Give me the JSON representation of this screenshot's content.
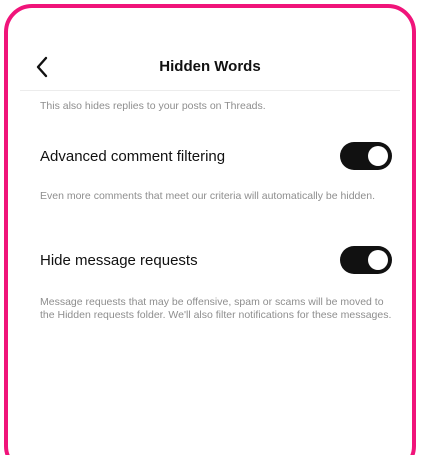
{
  "header": {
    "title": "Hidden Words",
    "back_icon": "chevron-left-icon"
  },
  "intro_note": "This also hides replies to your posts on Threads.",
  "settings": [
    {
      "label": "Advanced comment filtering",
      "enabled": true,
      "description": "Even more comments that meet our criteria will automatically be hidden."
    },
    {
      "label": "Hide message requests",
      "enabled": true,
      "description": "Message requests that may be offensive, spam or scams will be moved to the Hidden requests folder. We'll also filter notifications for these messages."
    }
  ],
  "colors": {
    "frame_border": "#f0147a",
    "toggle_on": "#111111",
    "secondary_text": "#8e8e8e"
  }
}
